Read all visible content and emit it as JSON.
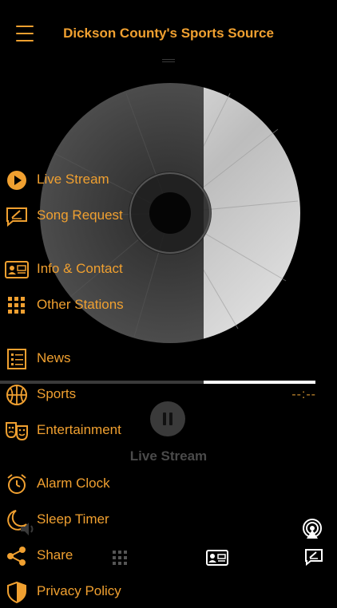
{
  "header": {
    "title": "Dickson County's Sports Source"
  },
  "player": {
    "time": "--:--",
    "station_label": "Live Stream",
    "progress": 0.355
  },
  "menu": {
    "items": [
      {
        "label": "Live Stream",
        "icon": "play-circle-icon"
      },
      {
        "label": "Song Request",
        "icon": "edit-message-icon"
      },
      {
        "label": "Info & Contact",
        "icon": "contact-card-icon"
      },
      {
        "label": "Other Stations",
        "icon": "grid-icon"
      },
      {
        "label": "News",
        "icon": "news-list-icon"
      },
      {
        "label": "Sports",
        "icon": "basketball-icon"
      },
      {
        "label": "Entertainment",
        "icon": "theater-masks-icon"
      },
      {
        "label": "Alarm Clock",
        "icon": "alarm-clock-icon"
      },
      {
        "label": "Sleep Timer",
        "icon": "moon-icon"
      },
      {
        "label": "Share",
        "icon": "share-icon"
      },
      {
        "label": "Privacy Policy",
        "icon": "shield-icon"
      }
    ]
  },
  "colors": {
    "accent": "#f0a030",
    "background": "#000000"
  }
}
